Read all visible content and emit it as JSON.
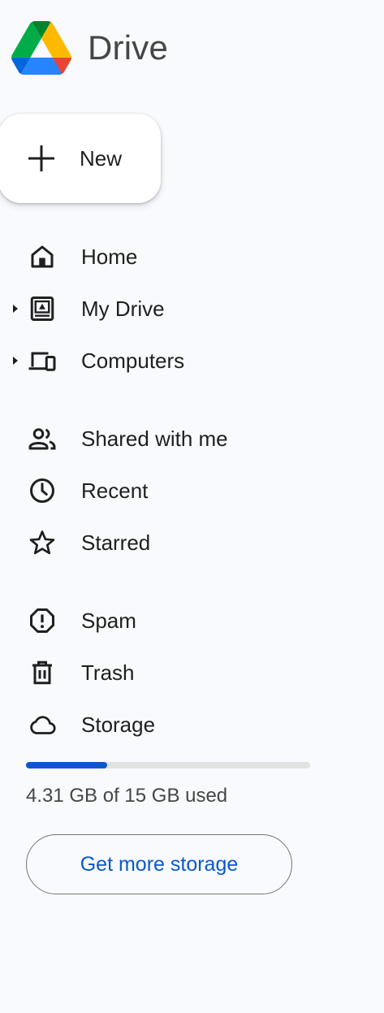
{
  "app": {
    "title": "Drive"
  },
  "new_button": {
    "label": "New"
  },
  "nav": {
    "items": [
      {
        "label": "Home",
        "icon": "home-icon"
      },
      {
        "label": "My Drive",
        "icon": "my-drive-icon",
        "expandable": true
      },
      {
        "label": "Computers",
        "icon": "computers-icon",
        "expandable": true
      },
      {
        "label": "Shared with me",
        "icon": "shared-icon"
      },
      {
        "label": "Recent",
        "icon": "clock-icon"
      },
      {
        "label": "Starred",
        "icon": "star-icon"
      },
      {
        "label": "Spam",
        "icon": "spam-icon"
      },
      {
        "label": "Trash",
        "icon": "trash-icon"
      },
      {
        "label": "Storage",
        "icon": "cloud-icon"
      }
    ]
  },
  "storage": {
    "used_text": "4.31 GB of 15 GB used",
    "used_fraction": 0.287,
    "button_label": "Get more storage"
  },
  "colors": {
    "background": "#f8fafd",
    "accent": "#0b57d0",
    "bar_track": "#e1e3e1"
  }
}
